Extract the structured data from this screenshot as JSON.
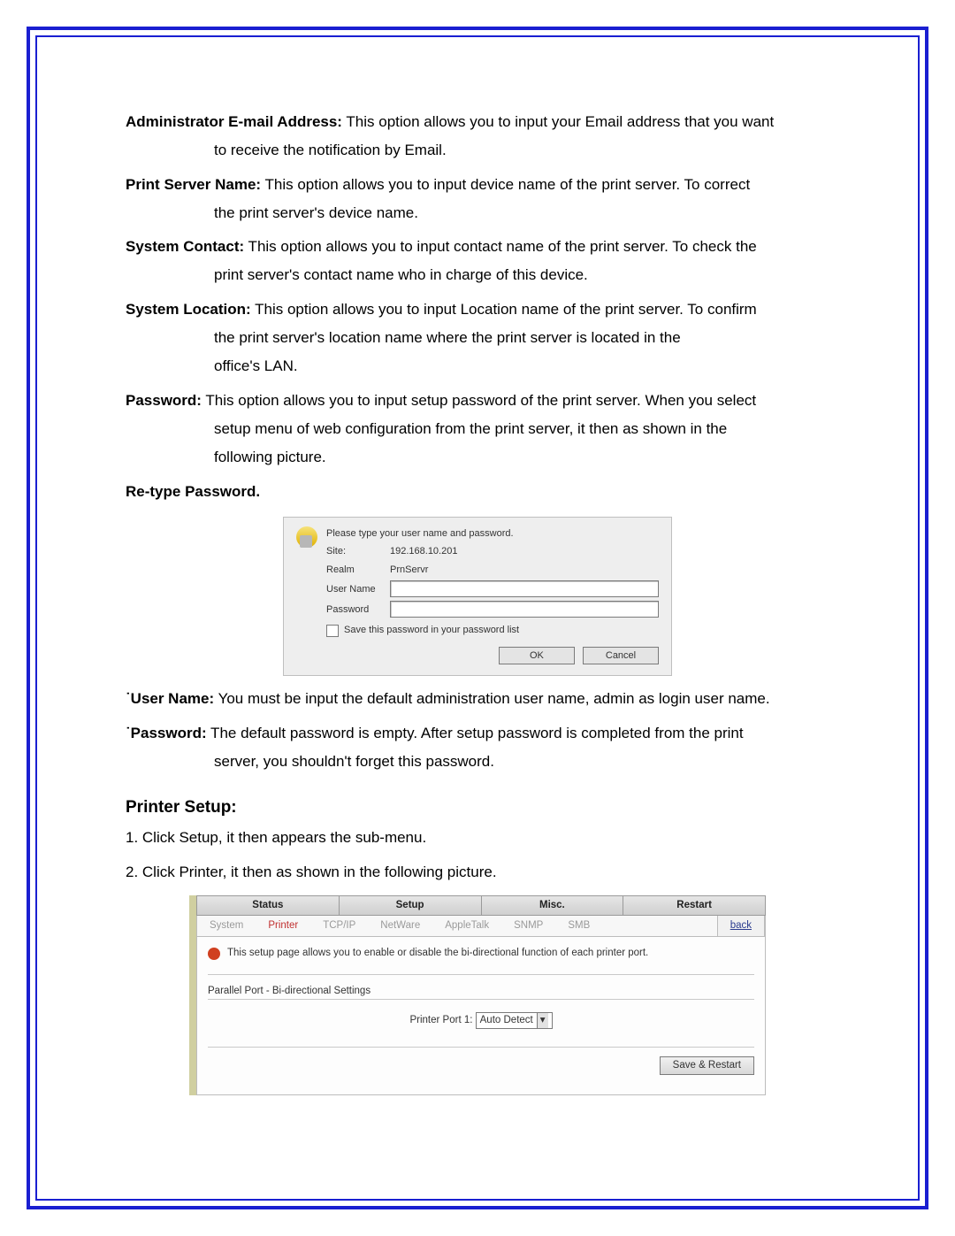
{
  "sections": {
    "admin_email": {
      "label": "Administrator E-mail Address:",
      "text1": " This option allows you to input your Email address that you want",
      "text2": "to receive the notification by Email."
    },
    "print_server_name": {
      "label": "Print Server Name:",
      "text1": " This option allows you to input device name of the print server. To correct",
      "text2": "the print server's device name."
    },
    "system_contact": {
      "label": "System Contact:",
      "text1": " This option allows you to input contact name of the print server. To check the",
      "text2": "print server's contact name who in charge of this device."
    },
    "system_location": {
      "label": "System Location:",
      "text1": " This option allows you to input Location name of the print server. To confirm",
      "text2": "the print server's location name where the print server is located in the",
      "text3": "office's LAN."
    },
    "password": {
      "label": "Password:",
      "text1": " This option allows you to input setup password of the print server. When you select",
      "text2": "setup menu of web configuration from the print server, it then as shown in the",
      "text3": "following picture."
    },
    "retype_password": "Re-type Password."
  },
  "dialog": {
    "prompt": "Please type your user name and password.",
    "rows": {
      "site_label": "Site:",
      "site_value": "192.168.10.201",
      "realm_label": "Realm",
      "realm_value": "PrnServr",
      "user_label": "User Name",
      "pass_label": "Password"
    },
    "checkbox": "Save this password in your password list",
    "ok": "OK",
    "cancel": "Cancel"
  },
  "notes": {
    "username": {
      "label": "˙User Name:",
      "text": " You must be input the default administration user name, admin as login user name."
    },
    "password": {
      "label": "˙Password:",
      "text1": " The default password is empty. After setup password is completed from the print",
      "text2": "server, you shouldn't forget this password."
    }
  },
  "printer_setup": {
    "heading": "Printer Setup:",
    "step1": "1. Click Setup, it then appears the sub-menu.",
    "step2": "2. Click Printer, it then as shown in the following picture."
  },
  "printer_shot": {
    "tabs": [
      "Status",
      "Setup",
      "Misc.",
      "Restart"
    ],
    "subtabs": [
      "System",
      "Printer",
      "TCP/IP",
      "NetWare",
      "AppleTalk",
      "SNMP",
      "SMB"
    ],
    "active_sub": "Printer",
    "back": "back",
    "info": "This setup page allows you to enable or disable the bi-directional function of each printer port.",
    "section": "Parallel Port - Bi-directional Settings",
    "field_label": "Printer Port 1:",
    "field_value": "Auto Detect",
    "save": "Save & Restart"
  }
}
